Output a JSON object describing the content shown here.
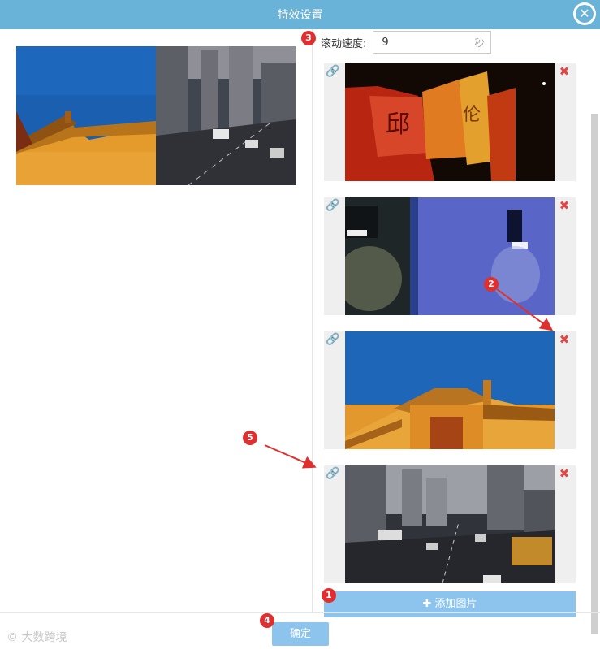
{
  "dialog": {
    "title": "特效设置"
  },
  "speed": {
    "label": "滚动速度:",
    "value": "9",
    "unit": "秒"
  },
  "items": [
    {
      "image": "red-lantern-signs"
    },
    {
      "image": "blue-wall-lamp"
    },
    {
      "image": "palace-gate-sky"
    },
    {
      "image": "city-street-traffic"
    }
  ],
  "buttons": {
    "add_label": "添加图片",
    "ok_label": "确定"
  },
  "markers": [
    "1",
    "2",
    "3",
    "4",
    "5"
  ],
  "watermark": "大数跨境",
  "colors": {
    "titlebar": "#69b3d9",
    "button": "#8cc4ee",
    "marker": "#e02f2f",
    "delete": "#e04848",
    "link": "#5ea4d8"
  }
}
